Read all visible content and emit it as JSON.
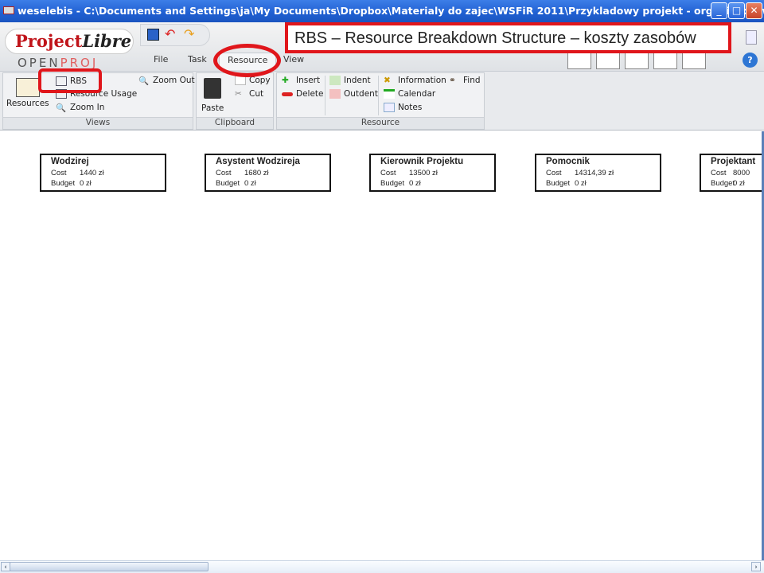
{
  "window": {
    "title": "weselebis - C:\\Documents and Settings\\ja\\My Documents\\Dropbox\\Materialy do zajec\\WSFiR 2011\\Przykladowy projekt - organizacja wesela.pod *"
  },
  "logo": {
    "brand1": "Project",
    "brand2": "Libre",
    "tm": "TM",
    "sub1": "OPEN",
    "sub2": "PROJ"
  },
  "tabs": [
    "File",
    "Task",
    "Resource",
    "View"
  ],
  "ribbon": {
    "views": {
      "label": "Views",
      "resources": "Resources",
      "rbs": "RBS",
      "resource_usage": "Resource Usage",
      "zoom_in": "Zoom In",
      "zoom_out": "Zoom Out"
    },
    "clipboard": {
      "label": "Clipboard",
      "paste": "Paste",
      "copy": "Copy",
      "cut": "Cut"
    },
    "resource": {
      "label": "Resource",
      "insert": "Insert",
      "delete": "Delete",
      "indent": "Indent",
      "outdent": "Outdent",
      "information": "Information",
      "calendar": "Calendar",
      "notes": "Notes",
      "find": "Find"
    }
  },
  "annotation": "RBS – Resource Breakdown Structure – koszty zasobów",
  "cost_label": "Cost",
  "budget_label": "Budget",
  "resources": [
    {
      "name": "Wodzirej",
      "cost": "1440 zł",
      "budget": "0 zł"
    },
    {
      "name": "Asystent Wodzireja",
      "cost": "1680 zł",
      "budget": "0 zł"
    },
    {
      "name": "Kierownik Projektu",
      "cost": "13500 zł",
      "budget": "0 zł"
    },
    {
      "name": "Pomocnik",
      "cost": "14314,39 zł",
      "budget": "0 zł"
    },
    {
      "name": "Projektant",
      "cost": "8000",
      "budget": "0 zł"
    }
  ],
  "colors": {
    "annotation": "#e0161b",
    "titlebar": "#1f5fd1"
  }
}
